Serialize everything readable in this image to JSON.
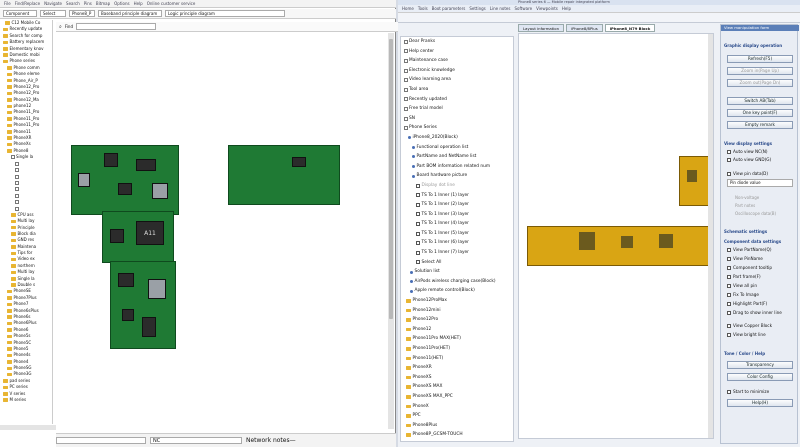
{
  "left_window": {
    "menu": [
      "File",
      "Find/Replace",
      "Navigate",
      "Search",
      "Pins",
      "Bitmap",
      "Options",
      "Help",
      "Online customer service"
    ],
    "toolbar": {
      "field1": "Component",
      "field2": "Select",
      "field3": "Phone8_P",
      "field4": "Baseband principle diagram",
      "field5": "Logic principle diagram",
      "find_label": "Find"
    },
    "tree_items": [
      "C12 Mobile Co",
      "Recently update",
      "Search for comp",
      "Battery replacem",
      "Elementary knov",
      "Domestic mobi",
      "Phone series",
      "Phone comm",
      "Phone eleme",
      "Phone_Air_P",
      "Phone12_Pro",
      "Phone12_Pro",
      "Phone12_Ma",
      "phone12",
      "Phone11_Pro",
      "Phone11_Pro",
      "Phone11_Pro",
      "Phone11",
      "PhoneXR",
      "PhoneXs",
      "Phone8",
      "Single la",
      "",
      "",
      "",
      "",
      "",
      "",
      "",
      "",
      "CPU ass",
      "Multi lay",
      "Principle",
      "Block dia",
      "GND res",
      "Maintena",
      "Tips for",
      "Video ex",
      "northern",
      "Multi lay",
      "Single la",
      "Double s",
      "PhoneSE",
      "Phone7Plus",
      "Phone7",
      "Phone6sPlus",
      "Phone6s",
      "Phone6Plus",
      "Phone6",
      "Phone5s",
      "Phone5C",
      "Phone5",
      "Phone4s",
      "Phone4",
      "PhoneSG",
      "Phone3G",
      "pad series",
      "PC series",
      "V series",
      "M series"
    ],
    "bottom_dropdown": "NC",
    "bottom_label": "Network notes—",
    "board_chip_label": "A11"
  },
  "right_window": {
    "title": "Phone8 series 6 — Mobile repair integrated platform",
    "menu": [
      "Home",
      "Tools",
      "Boot parameters",
      "Settings",
      "Line notes",
      "Software",
      "Viewpoints",
      "Help"
    ],
    "tabs": [
      "Layout information",
      "iPhone8/8Plus",
      "iPhone8_N79 Block"
    ],
    "nav_tree": [
      "Dear Pranks",
      "Help center",
      "Maintenance case",
      "Electronic knowledge",
      "Video learning area",
      "Tool area",
      "Recently updated",
      "Free trial model",
      "SN",
      "Phone Series",
      "iPhone8_2020(Block)",
      "Functional operation list",
      "PartName and NetName list",
      "Part BOM information related num",
      "Board hardware picture",
      "Display dot line",
      "TS To 1 Inner (1) layer",
      "TS To 1 Inner (2) layer",
      "TS To 1 Inner (3) layer",
      "TS To 1 Inner (4) layer",
      "TS To 1 Inner (5) layer",
      "TS To 1 Inner (6) layer",
      "TS To 1 Inner (7) layer",
      "Select All",
      "Solution list",
      "AirPods wireless charging case(Block)",
      "Apple remote control(Block)",
      "Phone12ProMax",
      "Phone12mini",
      "Phone12Pro",
      "Phone12",
      "Phone11Pro MAX(HET)",
      "Phone11Pro(HET)",
      "Phone11(HET)",
      "PhoneXR",
      "PhoneXS",
      "PhoneXS MAX",
      "PhoneXS MAX_PPC",
      "PhoneX",
      "PPC",
      "Phone8Plus",
      "Phone8P_GCSM-TOUCH"
    ],
    "side_panel": {
      "title": "View manipulation form",
      "section_graphic": "Graphic display operation",
      "btn_refresh": "Refresh(F5)",
      "btn_zoom_in": "Zoom in(Page Up)",
      "btn_zoom_out": "Zoom out(Page Dn)",
      "btn_switch": "Switch AB(Tab)",
      "btn_key_point": "One key point(F)",
      "btn_empty": "Empty remark",
      "section_view": "View display settings",
      "opt_auto_view_nc": "Auto view NC(N)",
      "opt_auto_view_gnd": "Auto view GND(G)",
      "opt_view_pin": "View pin data(D)",
      "select_pin": "Pin diode value",
      "gray1": "Non-voltage",
      "gray2": "Part notes",
      "gray3": "Oscilloscope data(B)",
      "section_schematic": "Schematic settings",
      "section_component": "Component data settings",
      "opt_part_name": "View PartName(Q)",
      "opt_pin_name": "View PinName",
      "opt_tooltip": "Component tooltip",
      "opt_part_frame": "Part frame(F)",
      "opt_view_all": "View all pin",
      "opt_fix_image": "Fix To Image",
      "opt_highlight": "Highlight Part(F)",
      "opt_drag": "Drag to show inner line",
      "opt_copper": "View Copper Block",
      "opt_bright": "View bright line",
      "section_tools": "Tone / Color / Help",
      "btn_transparency": "Transparency",
      "btn_color": "Color Config",
      "opt_minimize": "Start to minimize",
      "btn_help": "Help(H)"
    }
  },
  "colors": {
    "board_green": "#1f7a34",
    "board_gold": "#d9a514",
    "folder": "#e8b533",
    "accent": "#2a4a8a"
  }
}
